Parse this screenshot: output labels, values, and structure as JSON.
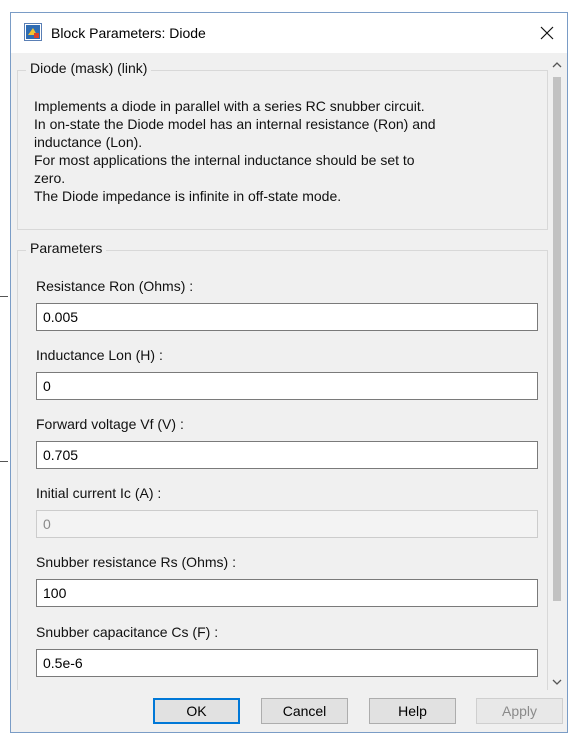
{
  "dialog": {
    "title": "Block Parameters: Diode"
  },
  "description_group": {
    "label": "Diode (mask) (link)",
    "lines": [
      "Implements a diode in parallel with a series RC snubber circuit.",
      "In on-state the Diode model has an internal resistance (Ron) and",
      "inductance (Lon).",
      "For most applications the internal inductance should be set to",
      "zero.",
      "The Diode impedance is infinite in off-state mode."
    ]
  },
  "parameters_group": {
    "label": "Parameters",
    "fields": [
      {
        "label": "Resistance Ron (Ohms) :",
        "value": "0.005",
        "enabled": true
      },
      {
        "label": "Inductance Lon (H) :",
        "value": "0",
        "enabled": true
      },
      {
        "label": "Forward voltage Vf (V) :",
        "value": "0.705",
        "enabled": true
      },
      {
        "label": "Initial current Ic (A) :",
        "value": "0",
        "enabled": false
      },
      {
        "label": "Snubber resistance Rs (Ohms) :",
        "value": "100",
        "enabled": true
      },
      {
        "label": "Snubber capacitance Cs (F) :",
        "value": "0.5e-6",
        "enabled": true
      }
    ]
  },
  "buttons": {
    "ok": "OK",
    "cancel": "Cancel",
    "help": "Help",
    "apply": "Apply"
  },
  "icons": {
    "app": "simulink-block-icon",
    "close": "close-icon",
    "scroll_up": "chevron-up-icon",
    "scroll_down": "chevron-down-icon"
  },
  "colors": {
    "dialog_background": "#f0f0f0",
    "default_button_border": "#0078d7",
    "window_border": "#7a9cc6"
  }
}
